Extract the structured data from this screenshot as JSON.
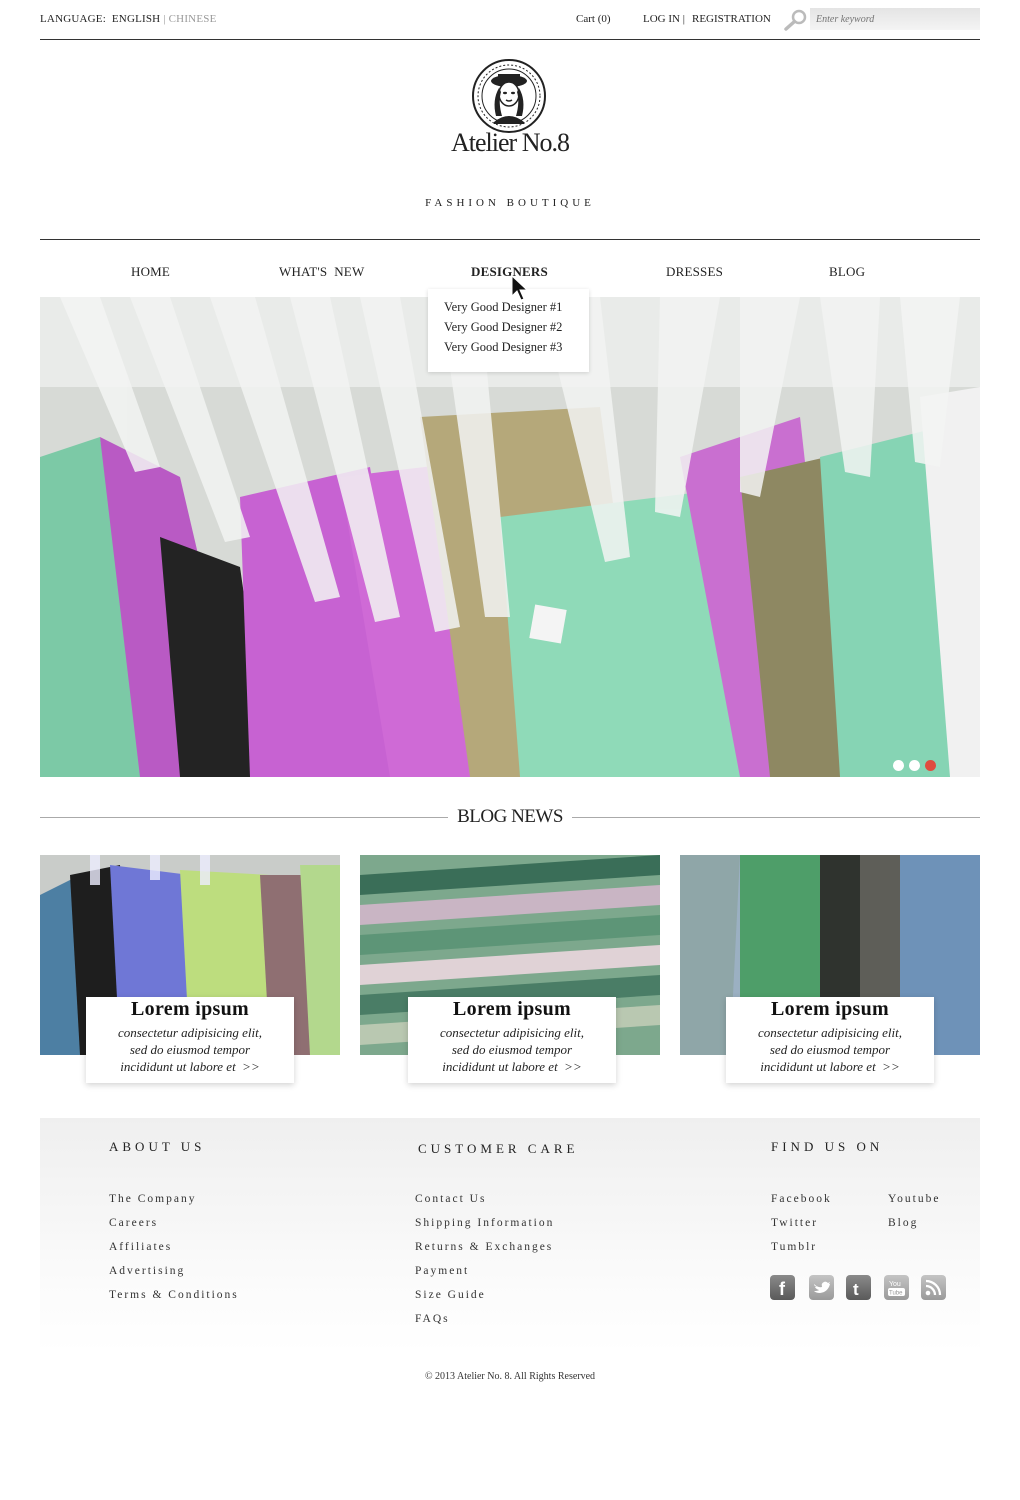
{
  "topbar": {
    "language_label": "LANGUAGE:",
    "language_english": "ENGLISH",
    "language_separator": "|",
    "language_chinese": "CHINESE",
    "cart": "Cart (0)",
    "login": "LOG IN",
    "login_separator": "|",
    "registration": "REGISTRATION",
    "search_placeholder": "Enter keyword"
  },
  "brand": {
    "name": "Atelier No.8",
    "tagline": "FASHION BOUTIQUE"
  },
  "nav": {
    "items": [
      "HOME",
      "WHAT'S  NEW",
      "DESIGNERS",
      "DRESSES",
      "BLOG"
    ],
    "active": "DESIGNERS",
    "dropdown": [
      "Very Good Designer #1",
      "Very Good Designer #2",
      "Very Good Designer #3"
    ]
  },
  "hero": {
    "slides": 3,
    "active_slide": 3,
    "colors": {
      "active_dot": "#e04c3f"
    }
  },
  "blog": {
    "title": "BLOG NEWS",
    "cards": [
      {
        "title": "Lorem ipsum",
        "line1": "consectetur adipisicing elit,",
        "line2": "sed do eiusmod tempor",
        "line3": "incididunt ut labore et  >>"
      },
      {
        "title": "Lorem ipsum",
        "line1": "consectetur adipisicing elit,",
        "line2": "sed do eiusmod tempor",
        "line3": "incididunt ut labore et  >>"
      },
      {
        "title": "Lorem ipsum",
        "line1": "consectetur adipisicing elit,",
        "line2": "sed do eiusmod tempor",
        "line3": "incididunt ut labore et  >>"
      }
    ]
  },
  "footer": {
    "about": {
      "heading": "ABOUT US",
      "links": [
        "The Company",
        "Careers",
        "Affiliates",
        "Advertising",
        "Terms & Conditions"
      ]
    },
    "care": {
      "heading": "CUSTOMER CARE",
      "links": [
        "Contact Us",
        "Shipping Information",
        "Returns & Exchanges",
        "Payment",
        "Size Guide",
        "FAQs"
      ]
    },
    "find": {
      "heading": "FIND US ON",
      "col1": [
        "Facebook",
        "Twitter",
        "Tumblr"
      ],
      "col2": [
        "Youtube",
        "Blog"
      ],
      "icons": [
        "facebook-icon",
        "twitter-icon",
        "tumblr-icon",
        "youtube-icon",
        "rss-icon"
      ],
      "icon_glyphs": {
        "facebook": "f",
        "tumblr": "t",
        "youtube_line1": "You",
        "youtube_line2": "Tube"
      }
    },
    "copyright": "© 2013 Atelier No. 8. All Rights Reserved"
  }
}
